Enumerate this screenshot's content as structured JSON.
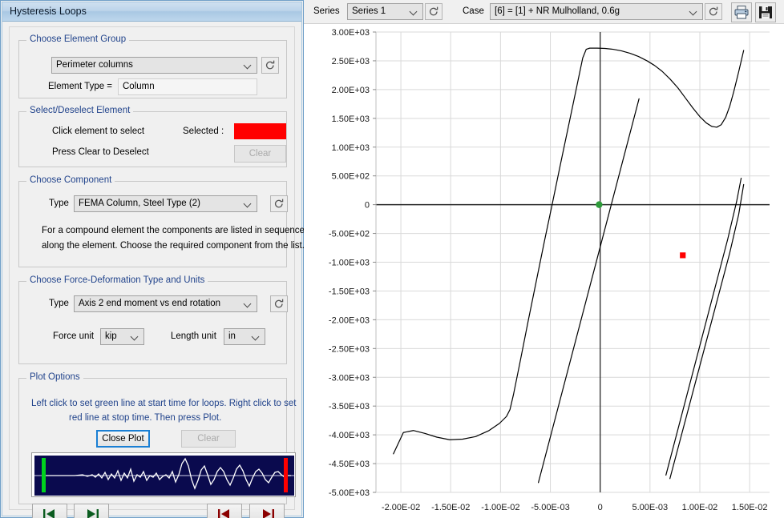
{
  "window": {
    "title": "Hysteresis Loops"
  },
  "element_group": {
    "legend": "Choose Element Group",
    "group_value": "Perimeter columns",
    "refresh_icon": "refresh-icon",
    "element_type_label": "Element Type =",
    "element_type_value": "Column"
  },
  "select_element": {
    "legend": "Select/Deselect Element",
    "line1": "Click element to select",
    "line2": "Press Clear to Deselect",
    "selected_label": "Selected :",
    "selected_color": "#FF0000",
    "clear_label": "Clear",
    "clear_disabled": true
  },
  "component": {
    "legend": "Choose Component",
    "type_label": "Type",
    "type_value": "FEMA Column, Steel Type (2)",
    "refresh_icon": "refresh-icon",
    "help_line1": "For a compound element the components are listed in sequence",
    "help_line2": "along the element. Choose the required component from the list."
  },
  "force_deformation": {
    "legend": "Choose Force-Deformation Type and Units",
    "type_label": "Type",
    "type_value": "Axis 2 end moment vs end rotation",
    "refresh_icon": "refresh-icon",
    "force_unit_label": "Force unit",
    "force_unit_value": "kip",
    "length_unit_label": "Length unit",
    "length_unit_value": "in"
  },
  "plot_options": {
    "legend": "Plot Options",
    "hint_line1": "Left click to set green line at start time for loops. Right click to set",
    "hint_line2": "red line at stop time. Then press Plot.",
    "close_plot_label": "Close Plot",
    "clear_label": "Clear",
    "clear_disabled": true,
    "timeline": {
      "start_marker_color": "#00d21e",
      "stop_marker_color": "#ff0000",
      "background_color": "#0a0a4e",
      "trace_color": "#ffffff"
    },
    "nav_buttons": [
      {
        "name": "step-start-green",
        "icon": "skip-back-icon",
        "color": "#0a5c1f"
      },
      {
        "name": "step-forward-green",
        "icon": "skip-forward-icon",
        "color": "#0a5c1f"
      },
      {
        "name": "step-back-red",
        "icon": "skip-back-icon",
        "color": "#8b0000"
      },
      {
        "name": "step-forward-red",
        "icon": "skip-forward-icon",
        "color": "#8b0000"
      }
    ]
  },
  "toolbar": {
    "series_label": "Series",
    "series_value": "Series 1",
    "series_refresh_icon": "refresh-icon",
    "case_label": "Case",
    "case_value": "[6] = [1] + NR Mulholland, 0.6g",
    "case_refresh_icon": "refresh-icon",
    "print_icon": "printer-icon",
    "save_icon": "save-floppy-icon"
  },
  "chart_data": {
    "type": "line",
    "title": "",
    "xlabel": "",
    "ylabel": "",
    "xlim": [
      -0.0225,
      0.017
    ],
    "ylim": [
      -5000,
      3000
    ],
    "xticks": [
      -0.02,
      -0.015,
      -0.01,
      -0.005,
      0,
      0.005,
      0.01,
      0.015
    ],
    "xtick_labels": [
      "-2.00E-02",
      "-1.50E-02",
      "-1.00E-02",
      "-5.00E-03",
      "0",
      "5.00E-03",
      "1.00E-02",
      "1.50E-02"
    ],
    "yticks": [
      3000,
      2500,
      2000,
      1500,
      1000,
      500,
      0,
      -500,
      -1000,
      -1500,
      -2000,
      -2500,
      -3000,
      -3500,
      -4000,
      -4500,
      -5000
    ],
    "ytick_labels": [
      "3.00E+03",
      "2.50E+03",
      "2.00E+03",
      "1.50E+03",
      "1.00E+03",
      "5.00E+02",
      "0",
      "-5.00E+02",
      "-1.00E+03",
      "-1.50E+03",
      "-2.00E+03",
      "-2.50E+03",
      "-3.00E+03",
      "-3.50E+03",
      "-4.00E+03",
      "-4.50E+03",
      "-5.00E+03"
    ],
    "grid": true,
    "legend": "none",
    "markers": [
      {
        "name": "start-marker",
        "x": -0.000105,
        "y": 0,
        "color": "#2e9b3a",
        "shape": "circle"
      },
      {
        "name": "stop-marker",
        "x": 0.00829,
        "y": -880,
        "color": "#ff0000",
        "shape": "square"
      }
    ],
    "series": [
      {
        "name": "Series 1",
        "color": "#000000",
        "points": [
          [
            -0.02075,
            -4330
          ],
          [
            -0.01975,
            -3960
          ],
          [
            -0.01875,
            -3925
          ],
          [
            -0.0176,
            -3975
          ],
          [
            -0.0164,
            -4040
          ],
          [
            -0.0151,
            -4085
          ],
          [
            -0.0138,
            -4075
          ],
          [
            -0.0125,
            -4030
          ],
          [
            -0.0112,
            -3930
          ],
          [
            -0.0101,
            -3800
          ],
          [
            -0.0094,
            -3680
          ],
          [
            -0.00905,
            -3560
          ],
          [
            -0.0087,
            -3300
          ],
          [
            -0.008,
            -2700
          ],
          [
            -0.0072,
            -2000
          ],
          [
            -0.0064,
            -1320
          ],
          [
            -0.0056,
            -640
          ],
          [
            -0.0048,
            20
          ],
          [
            -0.004,
            690
          ],
          [
            -0.0032,
            1350
          ],
          [
            -0.0024,
            2010
          ],
          [
            -0.00175,
            2550
          ],
          [
            -0.0014,
            2700
          ],
          [
            -0.00105,
            2720
          ],
          [
            -0.0003,
            2720
          ],
          [
            0.0005,
            2715
          ],
          [
            0.0013,
            2700
          ],
          [
            0.00215,
            2672
          ],
          [
            0.003,
            2630
          ],
          [
            0.00385,
            2575
          ],
          [
            0.0047,
            2500
          ],
          [
            0.00545,
            2420
          ],
          [
            0.0062,
            2320
          ],
          [
            0.007,
            2185
          ],
          [
            0.0078,
            2030
          ],
          [
            0.00855,
            1855
          ],
          [
            0.0093,
            1680
          ],
          [
            0.01,
            1530
          ],
          [
            0.01065,
            1420
          ],
          [
            0.0112,
            1360
          ],
          [
            0.0117,
            1345
          ],
          [
            0.01215,
            1390
          ],
          [
            0.0126,
            1520
          ],
          [
            0.013,
            1710
          ],
          [
            0.0134,
            1960
          ],
          [
            0.0139,
            2310
          ],
          [
            0.0144,
            2680
          ]
        ],
        "unload_branches": [
          {
            "name": "major-unload-branch",
            "points": [
              [
                -0.0062,
                -4830
              ],
              [
                0.0039,
                1840
              ]
            ]
          },
          {
            "name": "minor-loop-branch-a",
            "points": [
              [
                0.0066,
                -4700
              ],
              [
                0.0128,
                -600
              ],
              [
                0.0137,
                60
              ],
              [
                0.01415,
                460
              ]
            ]
          },
          {
            "name": "minor-loop-branch-b",
            "points": [
              [
                0.007,
                -4760
              ],
              [
                0.013,
                -840
              ],
              [
                0.0139,
                -170
              ],
              [
                0.0144,
                350
              ]
            ]
          }
        ]
      }
    ]
  }
}
